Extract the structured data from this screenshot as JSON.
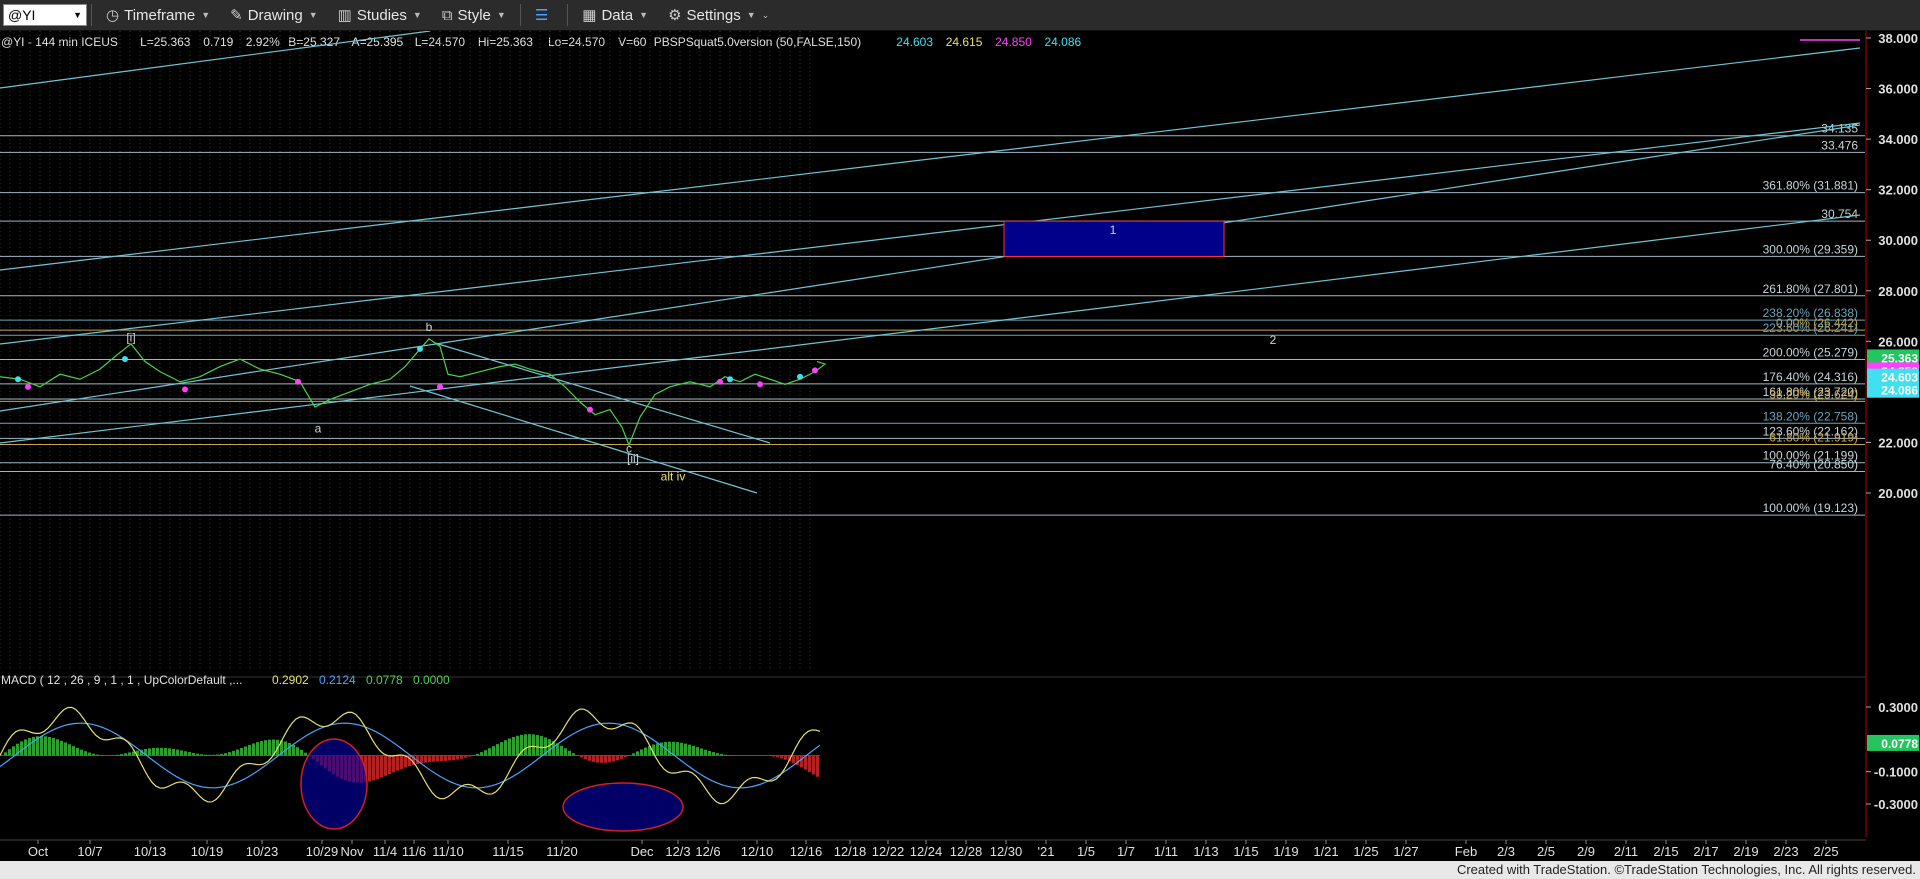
{
  "toolbar": {
    "symbol": "@YI",
    "timeframe": "Timeframe",
    "drawing": "Drawing",
    "studies": "Studies",
    "style": "Style",
    "data": "Data",
    "settings": "Settings"
  },
  "header": {
    "parts": [
      {
        "text": "@YI - 144 min ICEUS",
        "color": "#e0e0e0"
      },
      {
        "text": "L=25.363",
        "color": "#e0e0e0"
      },
      {
        "text": "0.719",
        "color": "#e0e0e0"
      },
      {
        "text": "2.92%",
        "color": "#e0e0e0"
      },
      {
        "text": "B=25.327",
        "color": "#e0e0e0"
      },
      {
        "text": "A=25.395",
        "color": "#e0e0e0"
      },
      {
        "text": "L=24.570",
        "color": "#e0e0e0"
      },
      {
        "text": "Hi=25.363",
        "color": "#e0e0e0"
      },
      {
        "text": "Lo=24.570",
        "color": "#e0e0e0"
      },
      {
        "text": "V=60",
        "color": "#e0e0e0"
      },
      {
        "text": "PBSPSquat5.0version (50,FALSE,150)",
        "color": "#e0e0e0"
      },
      {
        "text": "24.603",
        "color": "#40e0f0"
      },
      {
        "text": "24.615",
        "color": "#e8e070"
      },
      {
        "text": "24.850",
        "color": "#ff40ff"
      },
      {
        "text": "24.086",
        "color": "#40e0f0"
      }
    ]
  },
  "chart_data": [
    {
      "type": "line",
      "description_series": "price",
      "y_ticks": [
        "38.000",
        "36.000",
        "34.000",
        "32.000",
        "30.000",
        "28.000",
        "26.000",
        "22.000",
        "20.000"
      ],
      "ylim": [
        19.0,
        38.4
      ],
      "x_ticks": [
        "Oct",
        "10/7",
        "10/13",
        "10/19",
        "10/23",
        "10/29",
        "Nov",
        "11/4",
        "11/6",
        "11/10",
        "11/15",
        "11/20",
        "Dec",
        "12/3",
        "12/6",
        "12/10",
        "12/16",
        "12/18",
        "12/22",
        "12/24",
        "12/28",
        "12/30",
        "'21",
        "1/5",
        "1/7",
        "1/11",
        "1/13",
        "1/15",
        "1/19",
        "1/21",
        "1/25",
        "1/27",
        "Feb",
        "2/3",
        "2/5",
        "2/9",
        "2/11",
        "2/15",
        "2/17",
        "2/19",
        "2/23",
        "2/25"
      ],
      "levels": [
        {
          "label": "34.135",
          "value": 34.135
        },
        {
          "label": "33.476",
          "value": 33.476
        },
        {
          "label": "361.80% (31.881)",
          "value": 31.881
        },
        {
          "label": "30.754",
          "value": 30.754
        },
        {
          "label": "300.00% (29.359)",
          "value": 29.359
        },
        {
          "label": "261.80% (27.801)",
          "value": 27.801
        },
        {
          "label": "238.20% (26.838)",
          "value": 26.838
        },
        {
          "label": "0.00% (26.442)",
          "value": 26.442
        },
        {
          "label": "223.60% (26.241)",
          "value": 26.241
        },
        {
          "label": "200.00% (25.279)",
          "value": 25.279
        },
        {
          "label": "176.40% (24.316)",
          "value": 24.316
        },
        {
          "label": "161.80% (23.720)",
          "value": 23.72
        },
        {
          "label": "38.20% (23.624)",
          "value": 23.624
        },
        {
          "label": "138.20% (22.758)",
          "value": 22.758
        },
        {
          "label": "123.60% (22.162)",
          "value": 22.162
        },
        {
          "label": "61.80% (21.919)",
          "value": 21.919
        },
        {
          "label": "100.00% (21.199)",
          "value": 21.199
        },
        {
          "label": "76.40% (20.850)",
          "value": 20.85
        },
        {
          "label": "100.00% (19.123)",
          "value": 19.123
        }
      ],
      "price_tags": [
        {
          "label": "25.363",
          "value": 25.363,
          "color": "#22c55e"
        },
        {
          "label": "24.850",
          "value": 24.85,
          "color": "#ff40ff"
        },
        {
          "label": "24.603",
          "value": 24.603,
          "color": "#40e0f0"
        },
        {
          "label": "24.086",
          "value": 24.086,
          "color": "#40e0f0"
        }
      ],
      "wave_labels": [
        {
          "text": "[i]",
          "x": 131,
          "y": 26.0
        },
        {
          "text": "b",
          "x": 429,
          "y": 26.4
        },
        {
          "text": "a",
          "x": 318,
          "y": 22.4
        },
        {
          "text": "c",
          "x": 629,
          "y": 21.6
        },
        {
          "text": "[ii]",
          "x": 633,
          "y": 21.2
        },
        {
          "text": "alt iv",
          "x": 673,
          "y": 20.5
        },
        {
          "text": "1",
          "x": 1113,
          "y": 30.25
        },
        {
          "text": "2",
          "x": 1273,
          "y": 25.9
        }
      ],
      "target_box": {
        "label": "1",
        "top": 30.754,
        "bottom": 29.359
      },
      "price_points": [
        [
          0,
          24.6
        ],
        [
          20,
          24.5
        ],
        [
          40,
          24.2
        ],
        [
          60,
          24.7
        ],
        [
          80,
          24.5
        ],
        [
          100,
          24.9
        ],
        [
          115,
          25.4
        ],
        [
          131,
          25.9
        ],
        [
          145,
          25.2
        ],
        [
          160,
          24.8
        ],
        [
          180,
          24.4
        ],
        [
          200,
          24.6
        ],
        [
          220,
          25.0
        ],
        [
          240,
          25.3
        ],
        [
          260,
          24.9
        ],
        [
          280,
          24.7
        ],
        [
          300,
          24.4
        ],
        [
          315,
          23.4
        ],
        [
          330,
          23.7
        ],
        [
          350,
          24.0
        ],
        [
          370,
          24.3
        ],
        [
          390,
          24.5
        ],
        [
          405,
          25.0
        ],
        [
          418,
          25.6
        ],
        [
          429,
          26.1
        ],
        [
          440,
          25.8
        ],
        [
          448,
          24.7
        ],
        [
          460,
          24.6
        ],
        [
          480,
          24.8
        ],
        [
          500,
          25.0
        ],
        [
          515,
          25.1
        ],
        [
          530,
          24.9
        ],
        [
          550,
          24.7
        ],
        [
          565,
          24.2
        ],
        [
          580,
          23.6
        ],
        [
          595,
          23.1
        ],
        [
          610,
          23.3
        ],
        [
          622,
          22.6
        ],
        [
          629,
          21.9
        ],
        [
          640,
          23.0
        ],
        [
          655,
          23.9
        ],
        [
          670,
          24.2
        ],
        [
          690,
          24.4
        ],
        [
          710,
          24.2
        ],
        [
          725,
          24.6
        ],
        [
          740,
          24.4
        ],
        [
          755,
          24.7
        ],
        [
          770,
          24.5
        ],
        [
          785,
          24.3
        ],
        [
          800,
          24.5
        ],
        [
          815,
          24.8
        ],
        [
          825,
          25.1
        ],
        [
          817,
          25.2
        ]
      ]
    },
    {
      "type": "bar",
      "title": "MACD ( 12 , 26 , 9 , 1 , 1 , UpColorDefault ,...",
      "values_label": [
        "0.2902",
        "0.2124",
        "0.0778",
        "0.0000"
      ],
      "y_ticks": [
        "0.3000",
        "-0.1000",
        "-0.3000"
      ],
      "ylim": [
        -0.38,
        0.42
      ],
      "current_tag": "0.0778"
    }
  ],
  "footer": {
    "text": "Created with TradeStation. ©TradeStation Technologies, Inc. All rights reserved."
  }
}
